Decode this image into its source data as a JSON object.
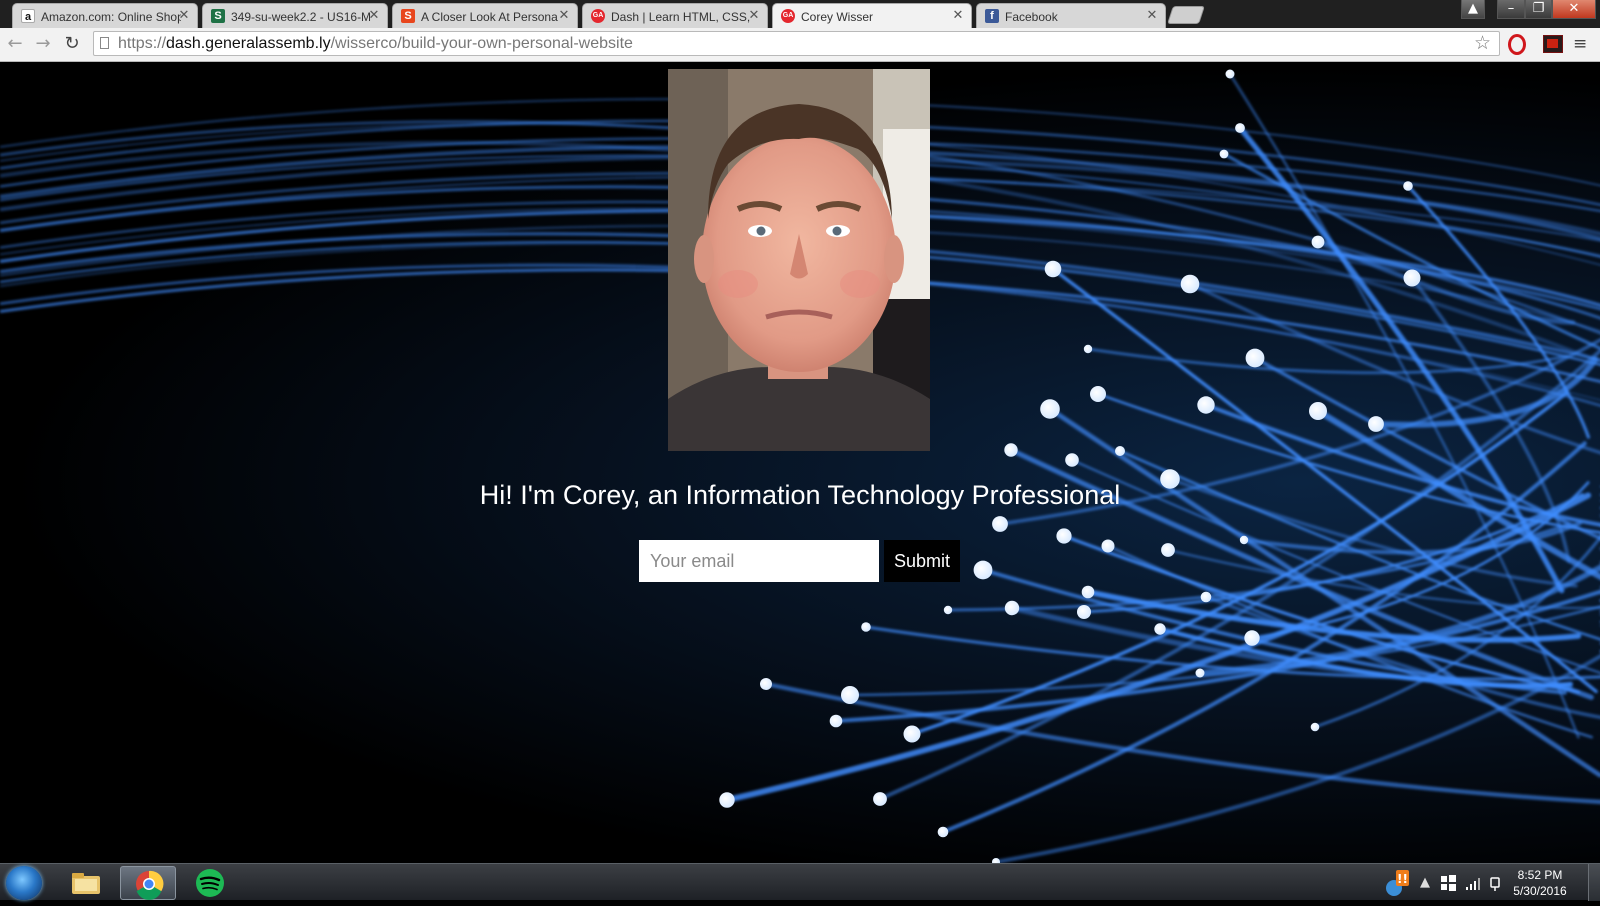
{
  "browser": {
    "tabs": [
      {
        "title": "Amazon.com: Online Shop",
        "favicon": "a",
        "favicon_color": "#111111",
        "active": false
      },
      {
        "title": "349-su-week2.2 - US16-M",
        "favicon": "S",
        "favicon_color": "#1e7145",
        "active": false
      },
      {
        "title": "A Closer Look At Persona",
        "favicon": "S",
        "favicon_color": "#e8461d",
        "active": false
      },
      {
        "title": "Dash | Learn HTML, CSS, J",
        "favicon": "GA",
        "favicon_color": "#e4272e",
        "active": false
      },
      {
        "title": "Corey Wisser",
        "favicon": "GA",
        "favicon_color": "#e4272e",
        "active": true
      },
      {
        "title": "Facebook",
        "favicon": "f",
        "favicon_color": "#3b5998",
        "active": false
      }
    ],
    "url": {
      "prefix": "https://",
      "host": "dash.generalassemb.ly",
      "path": "/wisserco/build-your-own-personal-website"
    }
  },
  "page": {
    "headline": "Hi! I'm Corey, an Information Technology Professional",
    "email_placeholder": "Your email",
    "submit_label": "Submit",
    "background_accent": "#3f8dff"
  },
  "taskbar": {
    "pinned": [
      "file-explorer-icon",
      "chrome-icon",
      "spotify-icon"
    ],
    "clock_time": "8:52 PM",
    "clock_date": "5/30/2016"
  }
}
